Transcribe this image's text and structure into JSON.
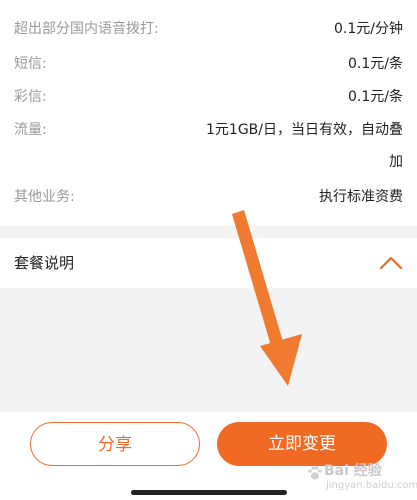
{
  "rates": [
    {
      "label": "超出部分国内语音拨打:",
      "value": "0.1元/分钟"
    },
    {
      "label": "短信:",
      "value": "0.1元/条"
    },
    {
      "label": "彩信:",
      "value": "0.1元/条"
    },
    {
      "label": "流量:",
      "value": "1元1GB/日，当日有效，自动叠",
      "value_cont": "加"
    },
    {
      "label": "其他业务:",
      "value": "执行标准资费"
    }
  ],
  "section": {
    "title": "套餐说明",
    "chevron_icon": "chevron-up-icon"
  },
  "actions": {
    "share_label": "分享",
    "change_label": "立即变更"
  },
  "watermark": {
    "text": "Bai 经验",
    "sub": "jingyan.baidu.com"
  },
  "colors": {
    "accent": "#f06a24",
    "annotation_arrow": "#f07a30",
    "label_gray": "#9a9a9a",
    "divider": "#f3f3f3"
  }
}
